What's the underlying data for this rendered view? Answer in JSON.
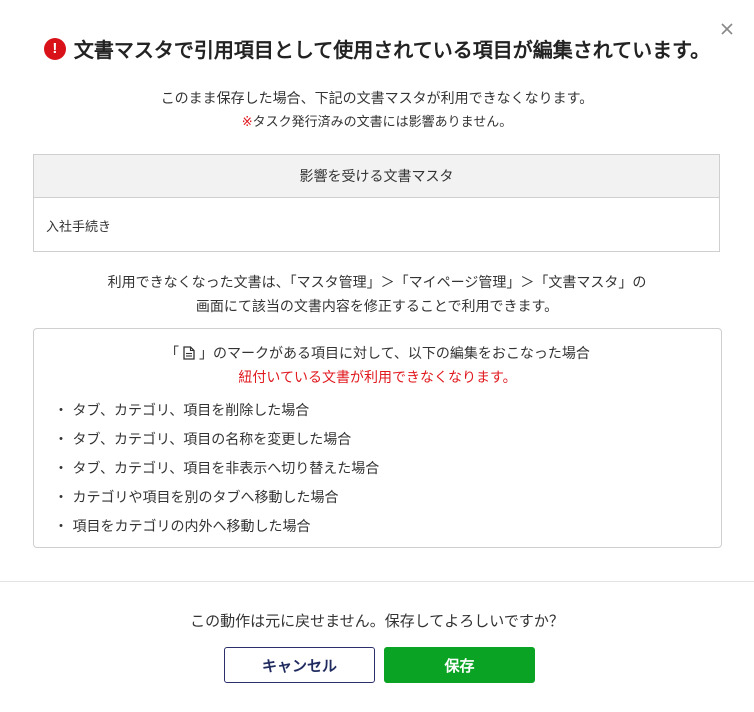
{
  "dialog": {
    "title": "文書マスタで引用項目として使用されている項目が編集されています。",
    "description_line1": "このまま保存した場合、下記の文書マスタが利用できなくなります。",
    "note_mark": "※",
    "note_text": "タスク発行済みの文書には影響ありません。",
    "table": {
      "header": "影響を受ける文書マスタ",
      "rows": [
        "入社手続き"
      ]
    },
    "info_line1": "利用できなくなった文書は、「マスタ管理」＞「マイページ管理」＞「文書マスタ」の",
    "info_line2": "画面にて該当の文書内容を修正することで利用できます。",
    "notice": {
      "head_before": "「",
      "head_after": "」のマークがある項目に対して、以下の編集をおこなった場合",
      "red_line": "紐付いている文書が利用できなくなります。",
      "items": [
        "・ タブ、カテゴリ、項目を削除した場合",
        "・ タブ、カテゴリ、項目の名称を変更した場合",
        "・ タブ、カテゴリ、項目を非表示へ切り替えた場合",
        "・ カテゴリや項目を別のタブへ移動した場合",
        "・ 項目をカテゴリの内外へ移動した場合"
      ]
    },
    "confirm_text": "この動作は元に戻せません。保存してよろしいですか？",
    "buttons": {
      "cancel": "キャンセル",
      "save": "保存"
    },
    "alert_glyph": "!",
    "icons": {
      "alert": "alert-icon",
      "close": "close-icon",
      "document": "document-icon"
    },
    "colors": {
      "alert_red": "#d9121a",
      "text_red": "#e0191f",
      "save_green": "#0aa324",
      "cancel_navy": "#1f2a5e"
    }
  }
}
